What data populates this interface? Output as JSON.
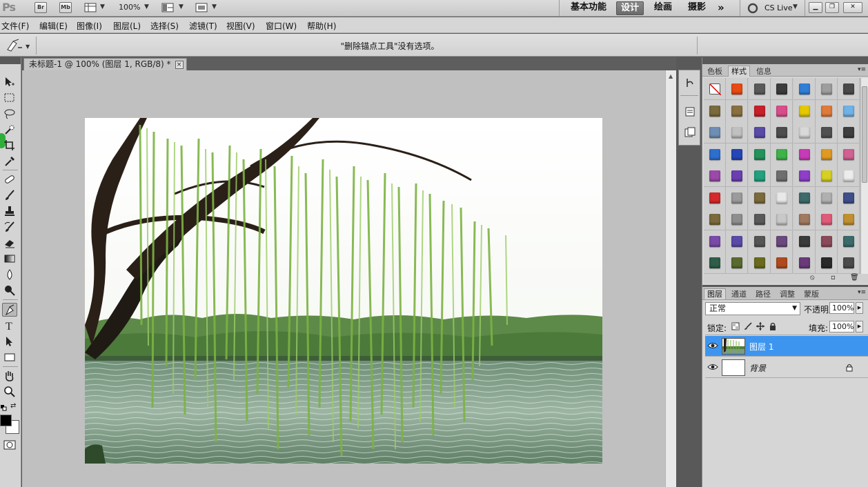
{
  "appbar": {
    "logo": "Ps",
    "bridge_badge": "Br",
    "minibridge_badge": "Mb",
    "zoom": "100%",
    "workspaces": [
      "基本功能",
      "设计",
      "绘画",
      "摄影"
    ],
    "active_workspace": "设计",
    "more": "»",
    "cs_live": "CS Live"
  },
  "menu": {
    "items": [
      "文件(F)",
      "编辑(E)",
      "图像(I)",
      "图层(L)",
      "选择(S)",
      "滤镜(T)",
      "视图(V)",
      "窗口(W)",
      "帮助(H)"
    ]
  },
  "options": {
    "message": "\"删除锚点工具\"没有选项。"
  },
  "document": {
    "tab_title": "未标题-1 @ 100% (图层 1, RGB/8) *",
    "close_glyph": "×"
  },
  "styles_panel": {
    "tabs": [
      "色板",
      "样式",
      "信息"
    ],
    "active_tab": "样式",
    "swatches": [
      "#ffffff",
      "#e84a12",
      "#5a5a5a",
      "#3b3b3b",
      "#2f7ed8",
      "#9e9e9e",
      "#4a4a4a",
      "#7a6a3c",
      "#8a6f3f",
      "#c8202a",
      "#d94e8a",
      "#e6c800",
      "#e07a3a",
      "#6fb2e8",
      "#6e8fb5",
      "#c0c0c0",
      "#5a4aa8",
      "#4d4d4d",
      "#d9d9d9",
      "#505050",
      "#3e3e3e",
      "#2d6fd0",
      "#2446b8",
      "#24935a",
      "#3fb24a",
      "#c83bb8",
      "#e09a20",
      "#d26090",
      "#9a4aa8",
      "#6a3fb0",
      "#23a07e",
      "#6f6f6f",
      "#8e3ec8",
      "#d6d020",
      "#ededed",
      "#d42a2a",
      "#9b9b9b",
      "#7a6a3c",
      "#e9e9e9",
      "#3e6b6b",
      "#b0b0b0",
      "#3e4e8a",
      "#7a6a3c",
      "#8e8e8e",
      "#5a5a5a",
      "#c8c8c8",
      "#a07a60",
      "#e05a7a",
      "#c09030",
      "#7a4aa8",
      "#5a4aa8",
      "#555555",
      "#6a4a7e",
      "#3a3a3a",
      "#8a4a5a",
      "#3a6a6a",
      "#2e5e4a",
      "#5a6a2e",
      "#6a6a1e",
      "#b04a1e",
      "#6a3a7a",
      "#2a2a2a",
      "#4a4a4a"
    ]
  },
  "layers_panel": {
    "tabs": [
      "图层",
      "通道",
      "路径",
      "调整",
      "蒙版"
    ],
    "active_tab": "图层",
    "blend_mode": "正常",
    "opacity_label": "不透明度:",
    "opacity_value": "100%",
    "lock_label": "锁定:",
    "fill_label": "填充:",
    "fill_value": "100%",
    "layers": [
      {
        "name": "图层 1",
        "selected": true
      },
      {
        "name": "背景",
        "selected": false
      }
    ]
  },
  "colors": {
    "accent": "#3d95f0",
    "foreground": "#000000",
    "background": "#ffffff"
  }
}
